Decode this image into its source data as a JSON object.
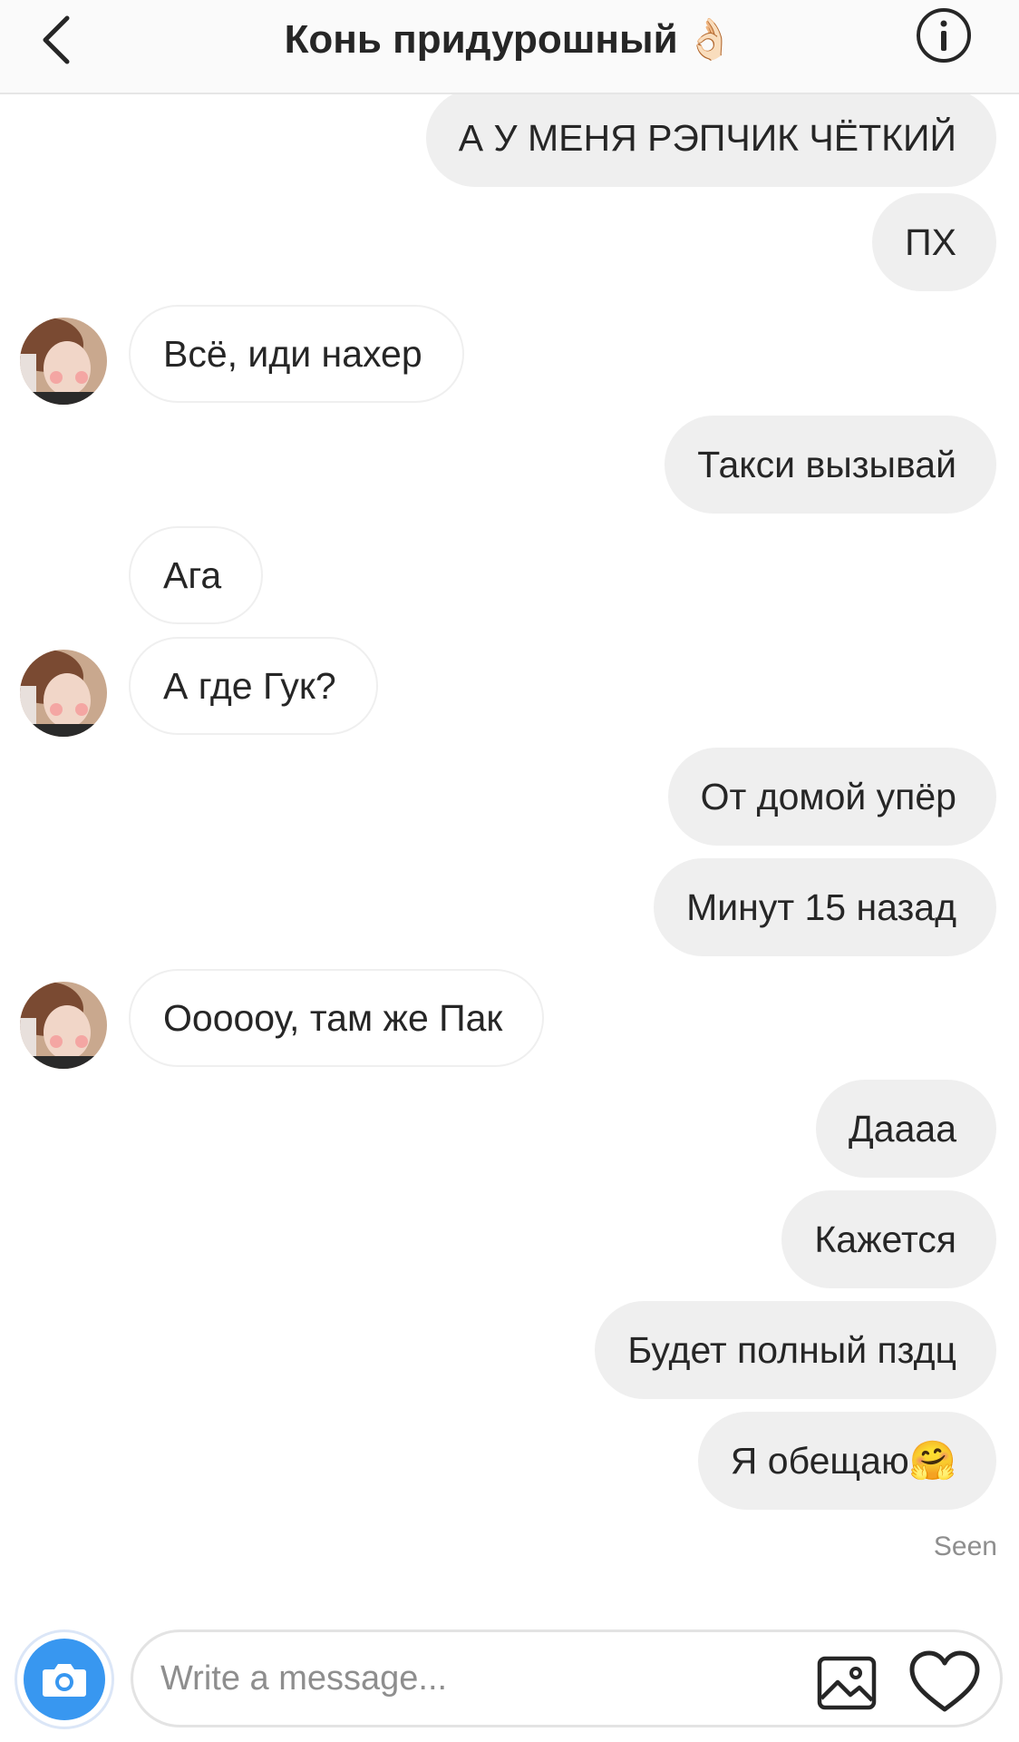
{
  "header": {
    "title": "Конь придурошный",
    "title_emoji": "👌🏻",
    "back_icon": "chevron-left-icon",
    "info_icon": "info-circle-icon"
  },
  "messages": [
    {
      "from": "me",
      "text": "А У МЕНЯ РЭПЧИК ЧЁТКИЙ"
    },
    {
      "from": "me",
      "text": "ПХ"
    },
    {
      "from": "them",
      "text": "Всё, иди нахер",
      "avatar": true
    },
    {
      "from": "me",
      "text": "Такси вызывай"
    },
    {
      "from": "them",
      "text": "Ага",
      "avatar": false
    },
    {
      "from": "them",
      "text": "А где Гук?",
      "avatar": true
    },
    {
      "from": "me",
      "text": "От домой упёр"
    },
    {
      "from": "me",
      "text": "Минут 15 назад"
    },
    {
      "from": "them",
      "text": "Оооооу, там же Пак",
      "avatar": true
    },
    {
      "from": "me",
      "text": "Даааа"
    },
    {
      "from": "me",
      "text": "Кажется"
    },
    {
      "from": "me",
      "text": "Будет полный пздц"
    },
    {
      "from": "me",
      "text": "Я обещаю",
      "emoji": "🤗"
    }
  ],
  "status": {
    "seen": "Seen"
  },
  "composer": {
    "placeholder": "Write a message...",
    "camera_icon": "camera-icon",
    "gallery_icon": "image-gallery-icon",
    "heart_icon": "heart-icon"
  },
  "colors": {
    "outgoing_bubble": "#efefef",
    "incoming_border": "#efefef",
    "accent": "#3897f0",
    "muted_text": "#8e8e8e"
  }
}
